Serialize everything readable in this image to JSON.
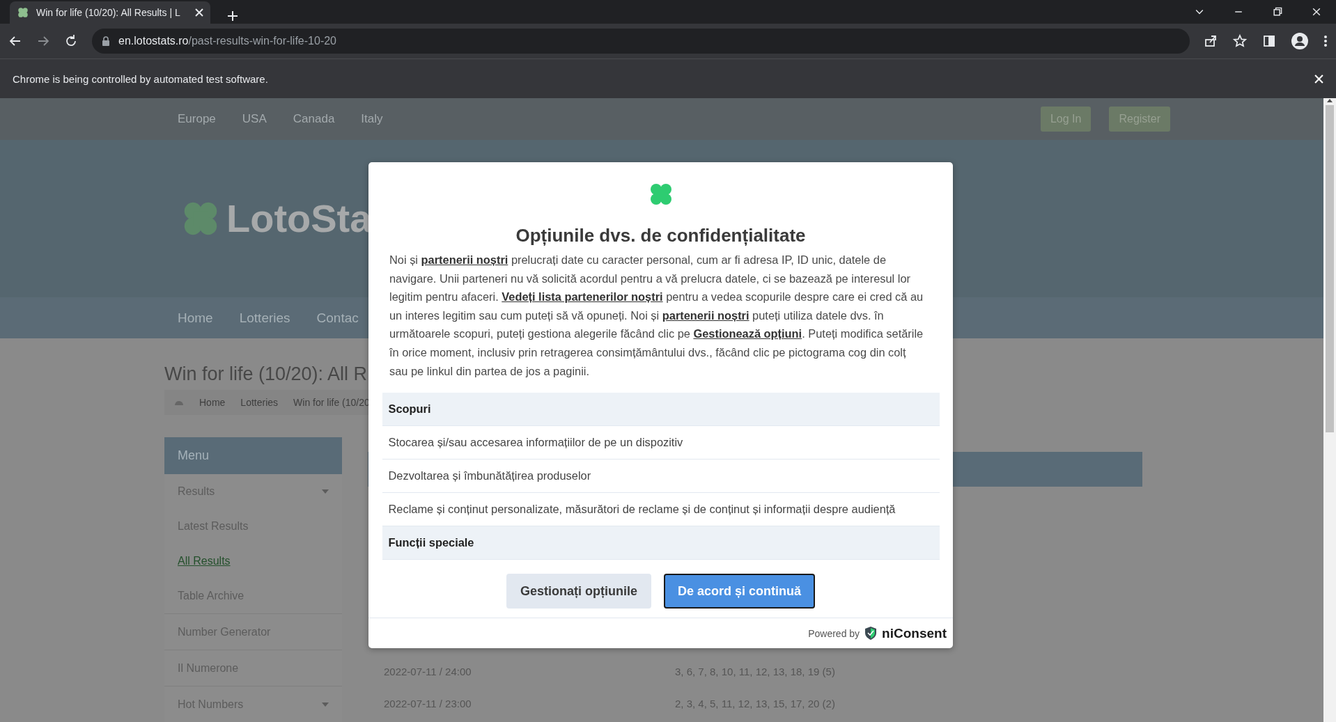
{
  "browser": {
    "tab_title": "Win for life (10/20): All Results | L",
    "url_host": "en.lotostats.ro",
    "url_path": "/past-results-win-for-life-10-20",
    "infobar": "Chrome is being controlled by automated test software."
  },
  "site": {
    "region_links": [
      "Europe",
      "USA",
      "Canada",
      "Italy"
    ],
    "account_buttons": [
      "Log In",
      "Register"
    ],
    "logo_text": "LotoSta",
    "nav": [
      "Home",
      "Lotteries",
      "Contac"
    ],
    "page_title": "Win for life (10/20): All R",
    "breadcrumb": [
      "Home",
      "Lotteries",
      "Win for life (10/20"
    ],
    "menu": {
      "title": "Menu",
      "items": [
        {
          "label": "Results",
          "kind": "dropdown",
          "selected": false
        },
        {
          "label": "Latest Results",
          "kind": "link",
          "selected": false
        },
        {
          "label": "All Results",
          "kind": "link",
          "selected": true
        },
        {
          "label": "Table Archive",
          "kind": "link",
          "selected": false
        },
        {
          "label": "Number Generator",
          "kind": "link",
          "selected": false
        },
        {
          "label": "Il Numerone",
          "kind": "link",
          "selected": false
        },
        {
          "label": "Hot Numbers",
          "kind": "dropdown",
          "selected": false
        }
      ]
    },
    "results": [
      {
        "date": "2022-07-11 / 24:00",
        "numbers": "3, 6, 7, 8, 10, 11, 12, 13, 18, 19 (5)"
      },
      {
        "date": "2022-07-11 / 23:00",
        "numbers": "2, 3, 4, 5, 11, 12, 13, 15, 17, 20 (2)"
      }
    ]
  },
  "dialog": {
    "title": "Opțiunile dvs. de confidențialitate",
    "body": [
      {
        "kind": "text",
        "text": "Noi și "
      },
      {
        "kind": "link",
        "text": "partenerii noștri"
      },
      {
        "kind": "text",
        "text": " prelucrați date cu caracter personal, cum ar fi adresa IP, ID unic, datele de navigare. Unii parteneri nu vă solicită acordul pentru a vă prelucra datele, ci se bazează pe interesul lor legitim pentru afaceri. "
      },
      {
        "kind": "link",
        "text": "Vedeți lista partenerilor noștri"
      },
      {
        "kind": "text",
        "text": " pentru a vedea scopurile despre care ei cred că au un interes legitim sau cum puteți să vă opuneți. Noi și "
      },
      {
        "kind": "link",
        "text": "partenerii noștri"
      },
      {
        "kind": "text",
        "text": " puteți utiliza datele dvs. în următoarele scopuri, puteți gestiona alegerile făcând clic pe "
      },
      {
        "kind": "link",
        "text": "Gestionează opțiuni"
      },
      {
        "kind": "text",
        "text": ". Puteți modifica setările în orice moment, inclusiv prin retragerea consimțământului dvs., făcând clic pe pictograma cog din colț sau pe linkul din partea de jos a paginii."
      }
    ],
    "sections": [
      {
        "kind": "header",
        "text": "Scopuri"
      },
      {
        "kind": "item",
        "text": "Stocarea și/sau accesarea informațiilor de pe un dispozitiv"
      },
      {
        "kind": "item",
        "text": "Dezvoltarea și îmbunătățirea produselor"
      },
      {
        "kind": "item",
        "text": "Reclame și conținut personalizate, măsurători de reclame și de conținut și informații despre audiență"
      },
      {
        "kind": "header",
        "text": "Funcții speciale"
      }
    ],
    "buttons": [
      {
        "kind": "secondary",
        "label": "Gestionați opțiunile"
      },
      {
        "kind": "primary",
        "label": "De acord și continuă"
      }
    ],
    "powered_by": "Powered by",
    "brand": "niConsent"
  }
}
